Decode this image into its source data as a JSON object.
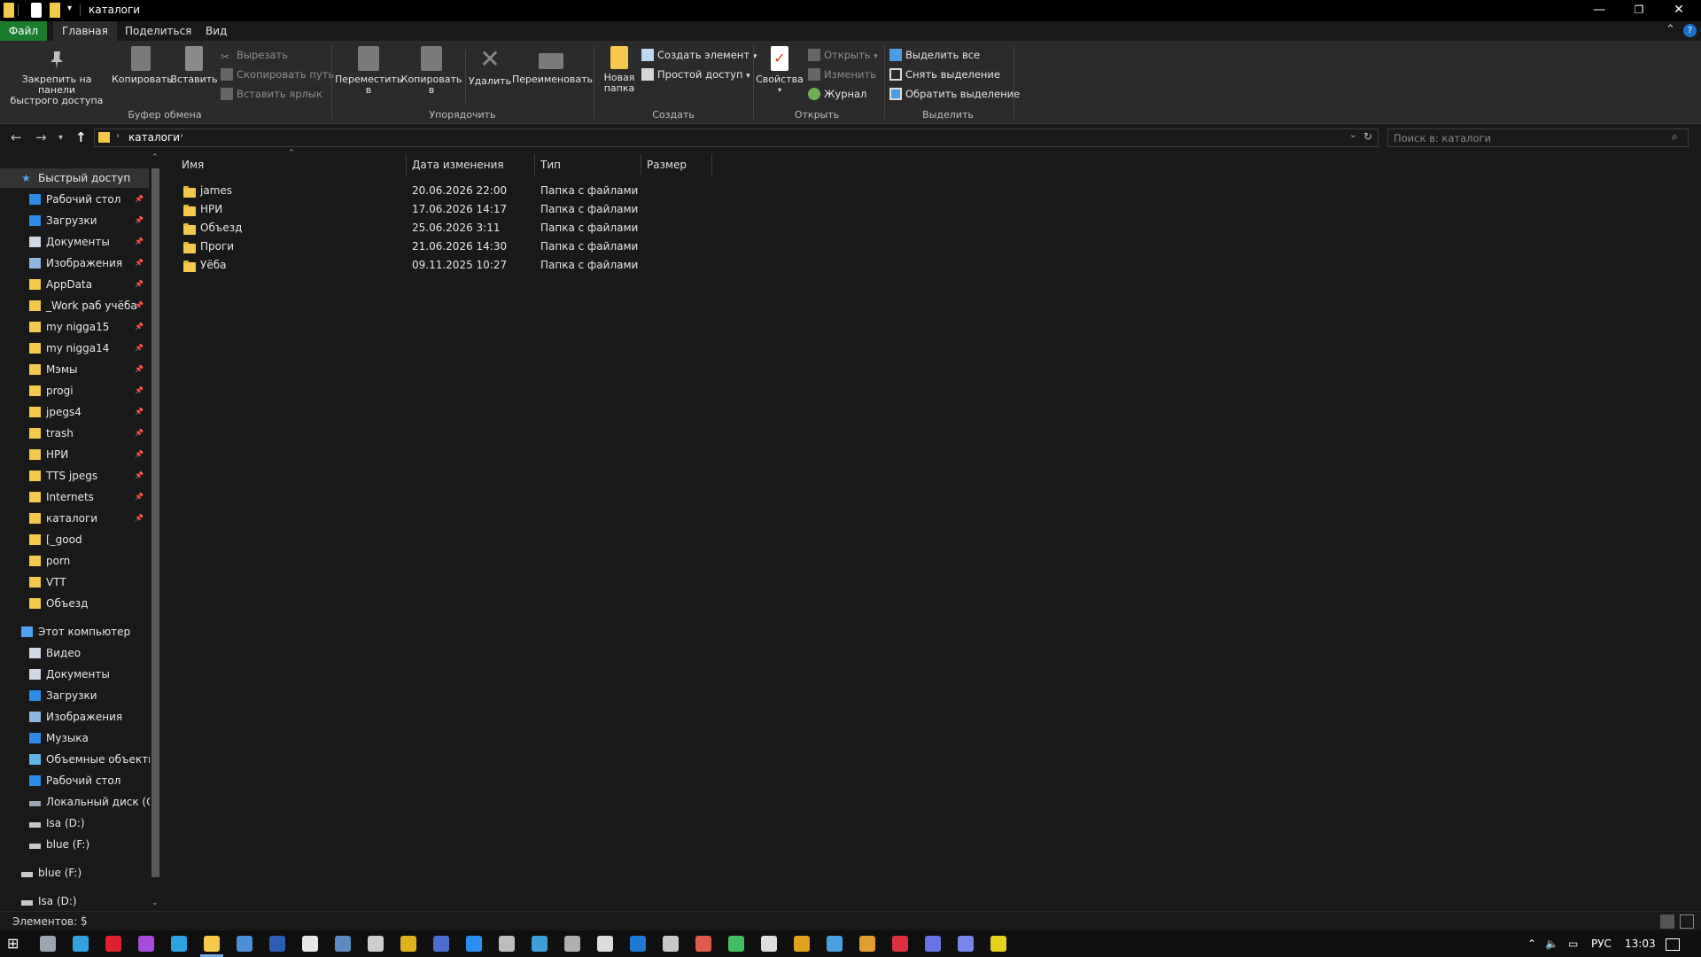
{
  "window": {
    "title": "каталоги",
    "minimize_glyph": "—",
    "maximize_glyph": "❐",
    "close_glyph": "✕"
  },
  "ribbon_tabs": [
    "Файл",
    "Главная",
    "Поделиться",
    "Вид"
  ],
  "ribbon": {
    "clipboard": {
      "pin_label_1": "Закрепить на панели",
      "pin_label_2": "быстрого доступа",
      "copy": "Копировать",
      "paste": "Вставить",
      "cut": "Вырезать",
      "copy_path": "Скопировать путь",
      "paste_shortcut": "Вставить ярлык",
      "group": "Буфер обмена"
    },
    "organize": {
      "move_1": "Переместить",
      "move_2": "в",
      "copy_1": "Копировать",
      "copy_2": "в",
      "delete": "Удалить",
      "rename": "Переименовать",
      "group": "Упорядочить"
    },
    "create": {
      "new_folder_1": "Новая",
      "new_folder_2": "папка",
      "new_item": "Создать элемент",
      "easy_access": "Простой доступ",
      "group": "Создать"
    },
    "open": {
      "properties": "Свойства",
      "open": "Открыть",
      "edit": "Изменить",
      "history": "Журнал",
      "group": "Открыть"
    },
    "select": {
      "select_all": "Выделить все",
      "select_none": "Снять выделение",
      "invert": "Обратить выделение",
      "group": "Выделить"
    }
  },
  "address": {
    "crumb": "каталоги",
    "search_placeholder": "Поиск в: каталоги"
  },
  "nav": {
    "quick_access": "Быстрый доступ",
    "quick_items": [
      {
        "label": "Рабочий стол",
        "icon": "desktop-icon",
        "pinned": true
      },
      {
        "label": "Загрузки",
        "icon": "downloads-icon",
        "pinned": true
      },
      {
        "label": "Документы",
        "icon": "documents-icon",
        "pinned": true
      },
      {
        "label": "Изображения",
        "icon": "pictures-icon",
        "pinned": true
      },
      {
        "label": "AppData",
        "icon": "folder-icon",
        "pinned": true
      },
      {
        "label": "_Work раб учёба",
        "icon": "folder-icon",
        "pinned": true
      },
      {
        "label": "my nigga15",
        "icon": "folder-icon",
        "pinned": true
      },
      {
        "label": "my nigga14",
        "icon": "folder-icon",
        "pinned": true
      },
      {
        "label": "Мэмы",
        "icon": "folder-icon",
        "pinned": true
      },
      {
        "label": "progi",
        "icon": "folder-icon",
        "pinned": true
      },
      {
        "label": "jpegs4",
        "icon": "folder-icon",
        "pinned": true
      },
      {
        "label": "trash",
        "icon": "folder-icon",
        "pinned": true
      },
      {
        "label": "НРИ",
        "icon": "folder-icon",
        "pinned": true
      },
      {
        "label": "TTS jpegs",
        "icon": "folder-icon",
        "pinned": true
      },
      {
        "label": "Internets",
        "icon": "folder-icon",
        "pinned": true
      },
      {
        "label": "каталоги",
        "icon": "folder-icon",
        "pinned": true
      },
      {
        "label": "[_good",
        "icon": "folder-icon",
        "pinned": false
      },
      {
        "label": "porn",
        "icon": "folder-icon",
        "pinned": false
      },
      {
        "label": "VTT",
        "icon": "folder-icon",
        "pinned": false
      },
      {
        "label": "Объезд",
        "icon": "folder-icon",
        "pinned": false
      }
    ],
    "this_pc": "Этот компьютер",
    "pc_items": [
      {
        "label": "Видео",
        "icon": "video-icon"
      },
      {
        "label": "Документы",
        "icon": "documents-icon"
      },
      {
        "label": "Загрузки",
        "icon": "downloads-icon"
      },
      {
        "label": "Изображения",
        "icon": "pictures-icon"
      },
      {
        "label": "Музыка",
        "icon": "music-icon"
      },
      {
        "label": "Объемные объекты",
        "icon": "3d-objects-icon"
      },
      {
        "label": "Рабочий стол",
        "icon": "desktop-icon"
      },
      {
        "label": "Локальный диск (C:)",
        "icon": "local-disk-icon"
      },
      {
        "label": "Isa (D:)",
        "icon": "drive-icon"
      },
      {
        "label": "blue (F:)",
        "icon": "drive-icon"
      }
    ],
    "drive_roots": [
      {
        "label": "blue (F:)",
        "icon": "drive-icon"
      },
      {
        "label": "Isa (D:)",
        "icon": "drive-icon"
      }
    ]
  },
  "columns": [
    "Имя",
    "Дата изменения",
    "Тип",
    "Размер"
  ],
  "files": [
    {
      "name": "james",
      "date": "20.06.2026 22:00",
      "type": "Папка с файлами"
    },
    {
      "name": "НРИ",
      "date": "17.06.2026 14:17",
      "type": "Папка с файлами"
    },
    {
      "name": "Объезд",
      "date": "25.06.2026 3:11",
      "type": "Папка с файлами"
    },
    {
      "name": "Проги",
      "date": "21.06.2026 14:30",
      "type": "Папка с файлами"
    },
    {
      "name": "Уёба",
      "date": "09.11.2025 10:27",
      "type": "Папка с файлами"
    }
  ],
  "status": {
    "items": "Элементов: 5"
  },
  "tray": {
    "lang": "РУС",
    "time": "13:03"
  },
  "colors": {
    "accent_file_tab": "#1b7d2c",
    "folder": "#f4c94c",
    "background": "#191919",
    "ribbon": "#2b2b2b"
  }
}
